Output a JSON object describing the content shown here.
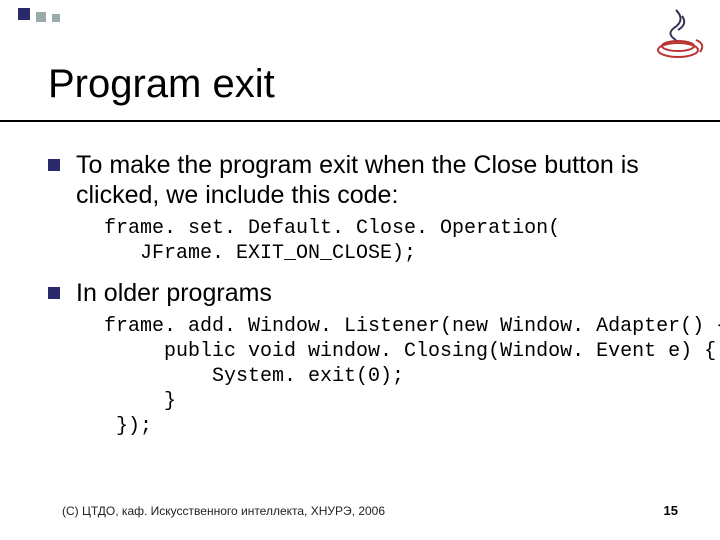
{
  "title": "Program exit",
  "bullets": [
    {
      "text": "To make the program exit when the Close button is clicked, we include this code:",
      "code": "frame. set. Default. Close. Operation(\n   JFrame. EXIT_ON_CLOSE);"
    },
    {
      "text": "In older programs",
      "code": "frame. add. Window. Listener(new Window. Adapter() {\n     public void window. Closing(Window. Event e) {\n         System. exit(0);\n     }\n });"
    }
  ],
  "footer": "(С) ЦТДО, каф. Искусственного интеллекта, ХНУРЭ, 2006",
  "page": "15"
}
